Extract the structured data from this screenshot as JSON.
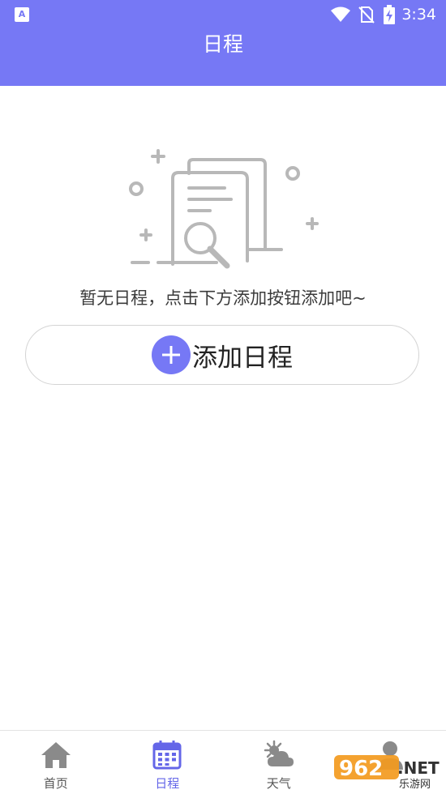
{
  "status_bar": {
    "time": "3:34",
    "app_icon": "A",
    "icons": [
      "wifi-icon",
      "no-sim-icon",
      "battery-charging-icon"
    ]
  },
  "header": {
    "title": "日程"
  },
  "empty_state": {
    "illustration": "document-search-icon",
    "message": "暂无日程，点击下方添加按钮添加吧~"
  },
  "add_button": {
    "icon": "plus-icon",
    "label": "添加日程"
  },
  "tabs": [
    {
      "label": "首页",
      "icon": "home-icon",
      "active": false
    },
    {
      "label": "日程",
      "icon": "calendar-icon",
      "active": true
    },
    {
      "label": "天气",
      "icon": "weather-icon",
      "active": false
    },
    {
      "label": "",
      "icon": "profile-icon",
      "active": false
    }
  ],
  "watermark": {
    "number": "962",
    "suffix": ".NET",
    "sub": "乐游网"
  },
  "colors": {
    "accent": "#7678f5",
    "active_tab": "#6466e8",
    "illustration": "#b8b8b8"
  }
}
